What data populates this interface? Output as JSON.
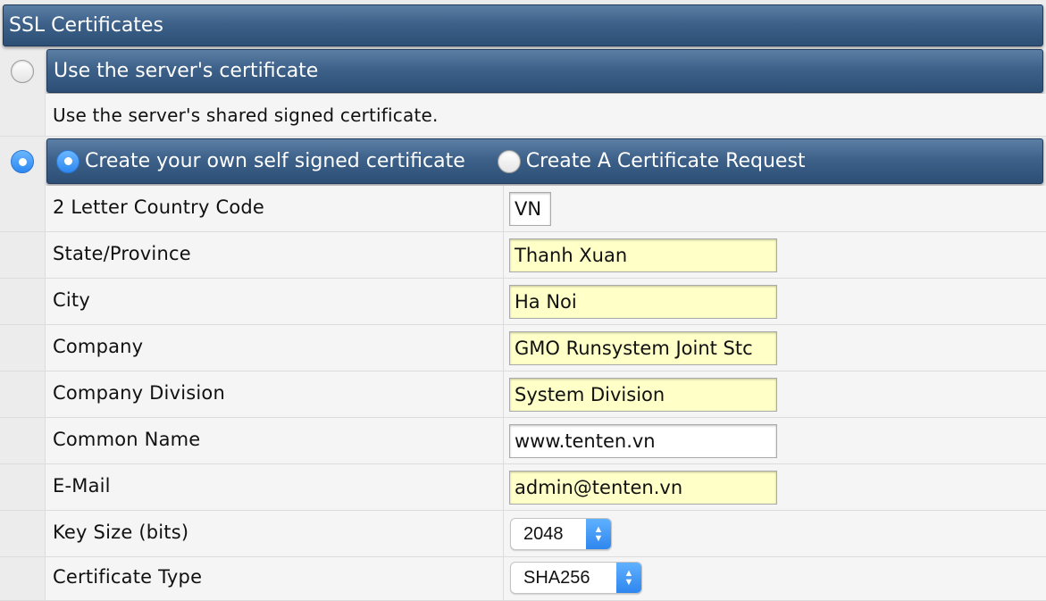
{
  "section": {
    "title": "SSL Certificates"
  },
  "option_server": {
    "label": "Use the server's certificate",
    "description": "Use the server's shared signed certificate.",
    "selected": false
  },
  "option_own": {
    "selected": true,
    "mode_self_signed": "Create your own self signed certificate",
    "mode_request": "Create A Certificate Request",
    "mode_selected": "self_signed"
  },
  "form": {
    "fields": [
      {
        "label": "2 Letter Country Code",
        "value": "VN"
      },
      {
        "label": "State/Province",
        "value": "Thanh Xuan"
      },
      {
        "label": "City",
        "value": "Ha Noi"
      },
      {
        "label": "Company",
        "value": "GMO Runsystem Joint Stc"
      },
      {
        "label": "Company Division",
        "value": "System Division"
      },
      {
        "label": "Common Name",
        "value": "www.tenten.vn"
      },
      {
        "label": "E-Mail",
        "value": "admin@tenten.vn"
      }
    ],
    "key_size": {
      "label": "Key Size (bits)",
      "value": "2048"
    },
    "cert_type": {
      "label": "Certificate Type",
      "value": "SHA256"
    }
  },
  "colors": {
    "header_blue": "#3d6189",
    "input_highlight": "#ffffc8",
    "radio_selected": "#2d88f0"
  }
}
